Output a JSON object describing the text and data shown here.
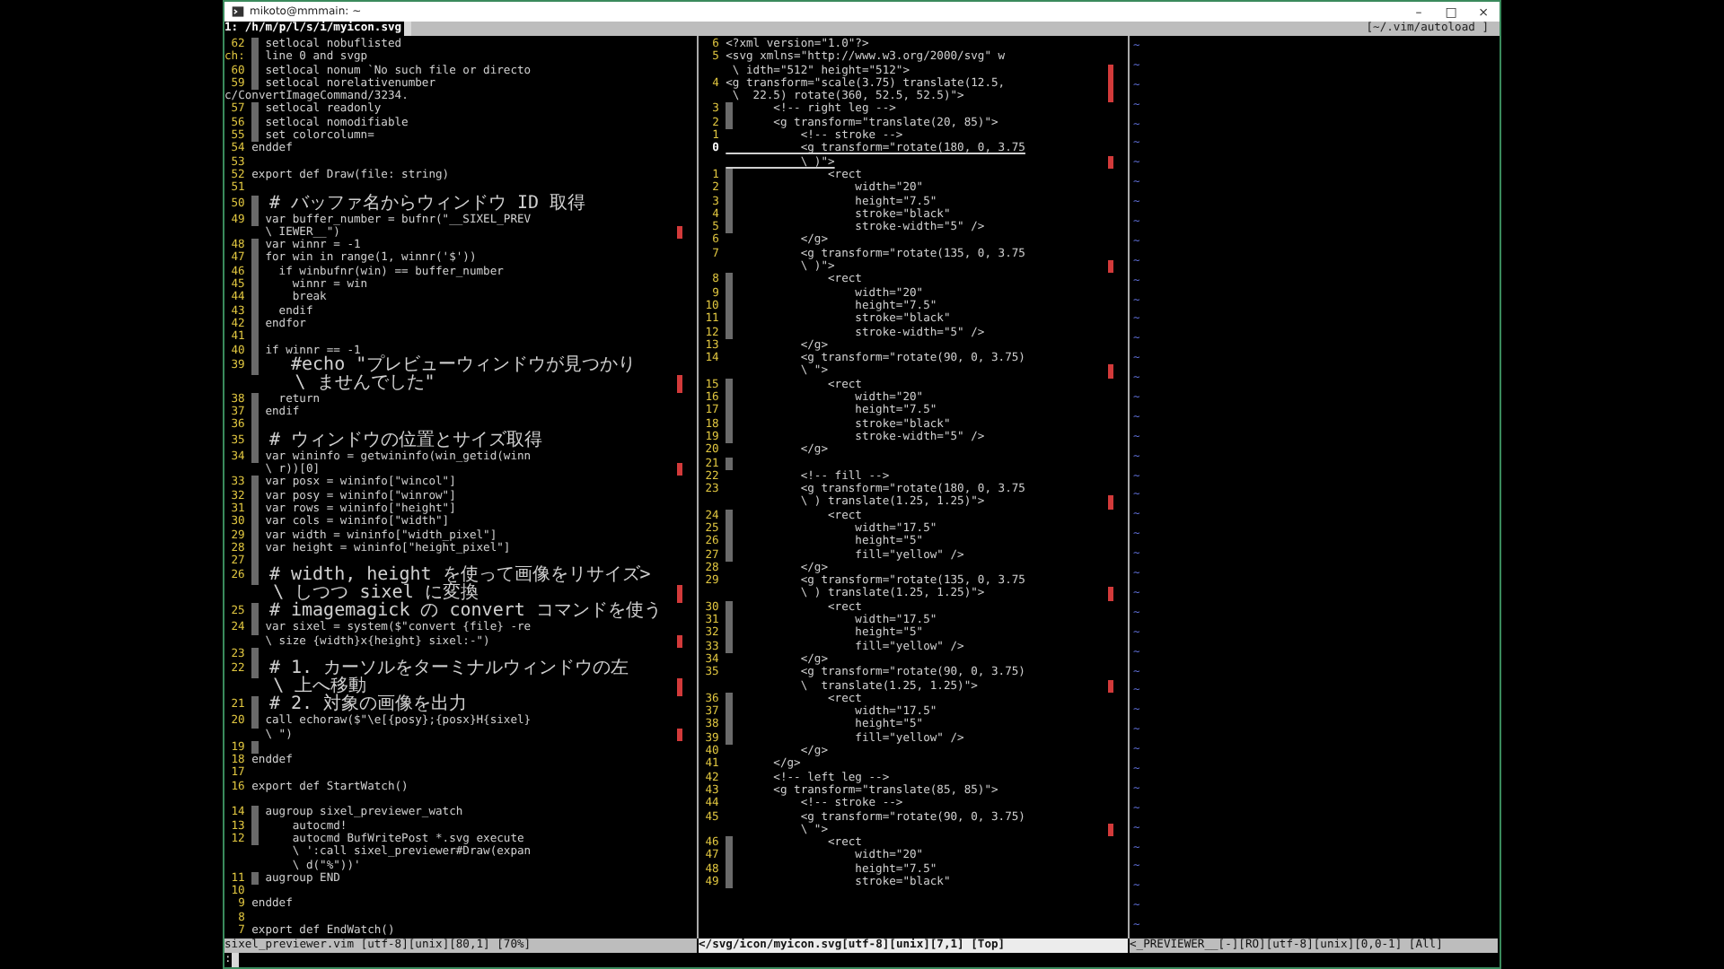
{
  "window": {
    "title": "mikoto@mmmain: ~",
    "controls": [
      "–",
      "□",
      "×"
    ]
  },
  "tabline": {
    "tabs": [
      {
        "label": "1: /h/m/p/l/s/i/myicon.svg",
        "selected": true
      }
    ],
    "cwd": "[~/.vim/autoload ]"
  },
  "panes": [
    {
      "active": false,
      "status": "sixel_previewer.vim [utf-8][unix][80,1] [70%]",
      "rows": [
        {
          "num": "62",
          "text": " setlocal nobuflisted",
          "guide": true,
          "marker": false
        },
        {
          "num": "ch:",
          "text": " line 0 and svgp",
          "guide": true,
          "marker": false
        },
        {
          "num": "60",
          "text": " setlocal nonum `No such file or directo",
          "guide": true,
          "marker": false
        },
        {
          "num": "59",
          "text": " setlocal norelativenumber",
          "guide": true,
          "marker": false
        },
        {
          "message": "c/ConvertImageCommand/3234.",
          "guide": false,
          "marker": false
        },
        {
          "num": "57",
          "text": " setlocal readonly",
          "guide": true,
          "marker": false
        },
        {
          "num": "56",
          "text": " setlocal nomodifiable",
          "guide": true,
          "marker": false
        },
        {
          "num": "55",
          "text": " set colorcolumn=",
          "guide": true,
          "marker": false
        },
        {
          "num": "54",
          "text": "enddef",
          "guide": false,
          "marker": false
        },
        {
          "num": "53",
          "guide": false,
          "marker": false
        },
        {
          "num": "52",
          "text": "export def Draw(file: string)",
          "guide": false,
          "marker": false
        },
        {
          "num": "51",
          "guide": false,
          "marker": false
        },
        {
          "num": "50",
          "text": " # バッファ名からウィンドウ ID 取得",
          "guide": true,
          "marker": false
        },
        {
          "num": "49",
          "text": " var buffer_number = bufnr(\"__SIXEL_PREV",
          "guide": true,
          "marker": false
        },
        {
          "text": "  \\ IEWER__\")",
          "guide": false,
          "marker": true
        },
        {
          "num": "48",
          "text": " var winnr = -1",
          "guide": true,
          "marker": false
        },
        {
          "num": "47",
          "text": " for win in range(1, winnr('$'))",
          "guide": true,
          "marker": false
        },
        {
          "num": "46",
          "text": "   if winbufnr(win) == buffer_number",
          "guide": true,
          "marker": false
        },
        {
          "num": "45",
          "text": "     winnr = win",
          "guide": true,
          "marker": false
        },
        {
          "num": "44",
          "text": "     break",
          "guide": true,
          "marker": false
        },
        {
          "num": "43",
          "text": "   endif",
          "guide": true,
          "marker": false
        },
        {
          "num": "42",
          "text": " endfor",
          "guide": true,
          "marker": false
        },
        {
          "num": "41",
          "guide": true,
          "marker": false
        },
        {
          "num": "40",
          "text": " if winnr == -1",
          "guide": true,
          "marker": false
        },
        {
          "num": "39",
          "text": "   #echo \"プレビューウィンドウが見つかり",
          "guide": true,
          "marker": false
        },
        {
          "text": "    \\ ませんでした\"",
          "guide": false,
          "marker": true
        },
        {
          "num": "38",
          "text": "   return",
          "guide": true,
          "marker": false
        },
        {
          "num": "37",
          "text": " endif",
          "guide": true,
          "marker": false
        },
        {
          "num": "36",
          "guide": true,
          "marker": false
        },
        {
          "num": "35",
          "text": " # ウィンドウの位置とサイズ取得",
          "guide": true,
          "marker": false
        },
        {
          "num": "34",
          "text": " var wininfo = getwininfo(win_getid(winn",
          "guide": true,
          "marker": false
        },
        {
          "text": "  \\ r))[0]",
          "guide": false,
          "marker": true
        },
        {
          "num": "33",
          "text": " var posx = wininfo[\"wincol\"]",
          "guide": true,
          "marker": false
        },
        {
          "num": "32",
          "text": " var posy = wininfo[\"winrow\"]",
          "guide": true,
          "marker": false
        },
        {
          "num": "31",
          "text": " var rows = wininfo[\"height\"]",
          "guide": true,
          "marker": false
        },
        {
          "num": "30",
          "text": " var cols = wininfo[\"width\"]",
          "guide": true,
          "marker": false
        },
        {
          "num": "29",
          "text": " var width = wininfo[\"width_pixel\"]",
          "guide": true,
          "marker": false
        },
        {
          "num": "28",
          "text": " var height = wininfo[\"height_pixel\"]",
          "guide": true,
          "marker": false
        },
        {
          "num": "27",
          "guide": true,
          "marker": false
        },
        {
          "num": "26",
          "text": " # width, height を使って画像をリサイズ>",
          "guide": true,
          "marker": false
        },
        {
          "text": "  \\ しつつ sixel に変換",
          "guide": false,
          "marker": true
        },
        {
          "num": "25",
          "text": " # imagemagick の convert コマンドを使う",
          "guide": true,
          "marker": false
        },
        {
          "num": "24",
          "text": " var sixel = system($\"convert {file} -re",
          "guide": true,
          "marker": false
        },
        {
          "text": "  \\ size {width}x{height} sixel:-\")",
          "guide": false,
          "marker": true
        },
        {
          "num": "23",
          "guide": true,
          "marker": false
        },
        {
          "num": "22",
          "text": " # 1. カーソルをターミナルウィンドウの左",
          "guide": true,
          "marker": false
        },
        {
          "text": "  \\ 上へ移動",
          "guide": false,
          "marker": true
        },
        {
          "num": "21",
          "text": " # 2. 対象の画像を出力",
          "guide": true,
          "marker": false
        },
        {
          "num": "20",
          "text": " call echoraw($\"\\e[{posy};{posx}H{sixel}",
          "guide": true,
          "marker": false
        },
        {
          "text": "  \\ \")",
          "guide": false,
          "marker": true
        },
        {
          "num": "19",
          "guide": true,
          "marker": false
        },
        {
          "num": "18",
          "text": "enddef",
          "guide": false,
          "marker": false
        },
        {
          "num": "17",
          "guide": false,
          "marker": false
        },
        {
          "num": "16",
          "text": "export def StartWatch()",
          "guide": false,
          "marker": false
        },
        {
          "guide": false,
          "marker": false
        },
        {
          "num": "14",
          "text": " augroup sixel_previewer_watch",
          "guide": true,
          "marker": false
        },
        {
          "num": "13",
          "text": "     autocmd!",
          "guide": true,
          "marker": false
        },
        {
          "num": "12",
          "text": "     autocmd BufWritePost *.svg execute",
          "guide": true,
          "marker": false
        },
        {
          "text": "      \\ ':call sixel_previewer#Draw(expan",
          "guide": false,
          "marker": false
        },
        {
          "text": "      \\ d(\"%\"))'",
          "guide": false,
          "marker": false
        },
        {
          "num": "11",
          "text": " augroup END",
          "guide": true,
          "marker": false
        },
        {
          "num": "10",
          "guide": false,
          "marker": false
        },
        {
          "num": "9",
          "text": "enddef",
          "guide": false,
          "marker": false
        },
        {
          "num": "8",
          "guide": false,
          "marker": false
        },
        {
          "num": "7",
          "text": "export def EndWatch()",
          "guide": false,
          "marker": false
        }
      ]
    },
    {
      "active": true,
      "status": "</svg/icon/myicon.svg[utf-8][unix][7,1] [Top]",
      "rows": [
        {
          "num": "6",
          "text": "<?xml version=\"1.0\"?>",
          "guide": false,
          "marker": false,
          "current": false
        },
        {
          "num": "5",
          "text": "<svg xmlns=\"http://www.w3.org/2000/svg\" w",
          "guide": false,
          "marker": false,
          "current": false
        },
        {
          "text": " \\ idth=\"512\" height=\"512\">",
          "guide": false,
          "marker": true,
          "current": false
        },
        {
          "num": "4",
          "text": "<g transform=\"scale(3.75) translate(12.5,",
          "guide": false,
          "marker": true,
          "current": false
        },
        {
          "text": " \\  22.5) rotate(360, 52.5, 52.5)\">",
          "guide": false,
          "marker": true,
          "current": false
        },
        {
          "num": "3",
          "text": "      <!-- right leg -->",
          "guide": true,
          "marker": false,
          "current": false
        },
        {
          "num": "2",
          "text": "      <g transform=\"translate(20, 85)\">",
          "guide": true,
          "marker": false,
          "current": false
        },
        {
          "num": "1",
          "text": "           <!-- stroke -->",
          "guide": false,
          "marker": false,
          "current": false
        },
        {
          "num": "0",
          "text": "           <g transform=\"rotate(180, 0, 3.75",
          "guide": false,
          "marker": false,
          "current": true
        },
        {
          "text": "           \\ )\">",
          "guide": false,
          "marker": true,
          "current": true
        },
        {
          "num": "1",
          "text": "              <rect",
          "guide": true,
          "marker": false,
          "current": false
        },
        {
          "num": "2",
          "text": "                  width=\"20\"",
          "guide": true,
          "marker": false,
          "current": false
        },
        {
          "num": "3",
          "text": "                  height=\"7.5\"",
          "guide": true,
          "marker": false,
          "current": false
        },
        {
          "num": "4",
          "text": "                  stroke=\"black\"",
          "guide": true,
          "marker": false,
          "current": false
        },
        {
          "num": "5",
          "text": "                  stroke-width=\"5\" />",
          "guide": true,
          "marker": false,
          "current": false
        },
        {
          "num": "6",
          "text": "           </g>",
          "guide": false,
          "marker": false,
          "current": false
        },
        {
          "num": "7",
          "text": "           <g transform=\"rotate(135, 0, 3.75",
          "guide": false,
          "marker": false,
          "current": false
        },
        {
          "text": "           \\ )\">",
          "guide": false,
          "marker": true,
          "current": false
        },
        {
          "num": "8",
          "text": "              <rect",
          "guide": true,
          "marker": false,
          "current": false
        },
        {
          "num": "9",
          "text": "                  width=\"20\"",
          "guide": true,
          "marker": false,
          "current": false
        },
        {
          "num": "10",
          "text": "                  height=\"7.5\"",
          "guide": true,
          "marker": false,
          "current": false
        },
        {
          "num": "11",
          "text": "                  stroke=\"black\"",
          "guide": true,
          "marker": false,
          "current": false
        },
        {
          "num": "12",
          "text": "                  stroke-width=\"5\" />",
          "guide": true,
          "marker": false,
          "current": false
        },
        {
          "num": "13",
          "text": "           </g>",
          "guide": false,
          "marker": false,
          "current": false
        },
        {
          "num": "14",
          "text": "           <g transform=\"rotate(90, 0, 3.75)",
          "guide": false,
          "marker": false,
          "current": false
        },
        {
          "text": "           \\ \">",
          "guide": false,
          "marker": true,
          "current": false
        },
        {
          "num": "15",
          "text": "              <rect",
          "guide": true,
          "marker": false,
          "current": false
        },
        {
          "num": "16",
          "text": "                  width=\"20\"",
          "guide": true,
          "marker": false,
          "current": false
        },
        {
          "num": "17",
          "text": "                  height=\"7.5\"",
          "guide": true,
          "marker": false,
          "current": false
        },
        {
          "num": "18",
          "text": "                  stroke=\"black\"",
          "guide": true,
          "marker": false,
          "current": false
        },
        {
          "num": "19",
          "text": "                  stroke-width=\"5\" />",
          "guide": true,
          "marker": false,
          "current": false
        },
        {
          "num": "20",
          "text": "           </g>",
          "guide": false,
          "marker": false,
          "current": false
        },
        {
          "num": "21",
          "guide": true,
          "marker": false,
          "current": false
        },
        {
          "num": "22",
          "text": "           <!-- fill -->",
          "guide": false,
          "marker": false,
          "current": false
        },
        {
          "num": "23",
          "text": "           <g transform=\"rotate(180, 0, 3.75",
          "guide": false,
          "marker": false,
          "current": false
        },
        {
          "text": "           \\ ) translate(1.25, 1.25)\">",
          "guide": false,
          "marker": true,
          "current": false
        },
        {
          "num": "24",
          "text": "              <rect",
          "guide": true,
          "marker": false,
          "current": false
        },
        {
          "num": "25",
          "text": "                  width=\"17.5\"",
          "guide": true,
          "marker": false,
          "current": false
        },
        {
          "num": "26",
          "text": "                  height=\"5\"",
          "guide": true,
          "marker": false,
          "current": false
        },
        {
          "num": "27",
          "text": "                  fill=\"yellow\" />",
          "guide": true,
          "marker": false,
          "current": false
        },
        {
          "num": "28",
          "text": "           </g>",
          "guide": false,
          "marker": false,
          "current": false
        },
        {
          "num": "29",
          "text": "           <g transform=\"rotate(135, 0, 3.75",
          "guide": false,
          "marker": false,
          "current": false
        },
        {
          "text": "           \\ ) translate(1.25, 1.25)\">",
          "guide": false,
          "marker": true,
          "current": false
        },
        {
          "num": "30",
          "text": "              <rect",
          "guide": true,
          "marker": false,
          "current": false
        },
        {
          "num": "31",
          "text": "                  width=\"17.5\"",
          "guide": true,
          "marker": false,
          "current": false
        },
        {
          "num": "32",
          "text": "                  height=\"5\"",
          "guide": true,
          "marker": false,
          "current": false
        },
        {
          "num": "33",
          "text": "                  fill=\"yellow\" />",
          "guide": true,
          "marker": false,
          "current": false
        },
        {
          "num": "34",
          "text": "           </g>",
          "guide": false,
          "marker": false,
          "current": false
        },
        {
          "num": "35",
          "text": "           <g transform=\"rotate(90, 0, 3.75)",
          "guide": false,
          "marker": false,
          "current": false
        },
        {
          "text": "           \\  translate(1.25, 1.25)\">",
          "guide": false,
          "marker": true,
          "current": false
        },
        {
          "num": "36",
          "text": "              <rect",
          "guide": true,
          "marker": false,
          "current": false
        },
        {
          "num": "37",
          "text": "                  width=\"17.5\"",
          "guide": true,
          "marker": false,
          "current": false
        },
        {
          "num": "38",
          "text": "                  height=\"5\"",
          "guide": true,
          "marker": false,
          "current": false
        },
        {
          "num": "39",
          "text": "                  fill=\"yellow\" />",
          "guide": true,
          "marker": false,
          "current": false
        },
        {
          "num": "40",
          "text": "           </g>",
          "guide": false,
          "marker": false,
          "current": false
        },
        {
          "num": "41",
          "text": "       </g>",
          "guide": false,
          "marker": false,
          "current": false
        },
        {
          "num": "42",
          "text": "       <!-- left leg -->",
          "guide": false,
          "marker": false,
          "current": false
        },
        {
          "num": "43",
          "text": "       <g transform=\"translate(85, 85)\">",
          "guide": false,
          "marker": false,
          "current": false
        },
        {
          "num": "44",
          "text": "           <!-- stroke -->",
          "guide": false,
          "marker": false,
          "current": false
        },
        {
          "num": "45",
          "text": "           <g transform=\"rotate(90, 0, 3.75)",
          "guide": false,
          "marker": false,
          "current": false
        },
        {
          "text": "           \\ \">",
          "guide": false,
          "marker": true,
          "current": false
        },
        {
          "num": "46",
          "text": "              <rect",
          "guide": true,
          "marker": false,
          "current": false
        },
        {
          "num": "47",
          "text": "                  width=\"20\"",
          "guide": true,
          "marker": false,
          "current": false
        },
        {
          "num": "48",
          "text": "                  height=\"7.5\"",
          "guide": true,
          "marker": false,
          "current": false
        },
        {
          "num": "49",
          "text": "                  stroke=\"black\"",
          "guide": true,
          "marker": false,
          "current": false
        }
      ]
    },
    {
      "active": false,
      "status": "<_PREVIEWER__[-][RO][utf-8][unix][0,0-1] [All]",
      "tildes": [
        "~",
        "~",
        "~",
        "~",
        "~",
        "~",
        "~",
        "~",
        "~",
        "~",
        "~",
        "~",
        "~",
        "~",
        "~",
        "~",
        "~",
        "~",
        "~",
        "~",
        "~",
        "~",
        "~",
        "~",
        "~",
        "~",
        "~",
        "~",
        "~",
        "~",
        "~",
        "~",
        "~",
        "~",
        "~",
        "~",
        "~",
        "~",
        "~",
        "~",
        "~",
        "~",
        "~",
        "~",
        "~",
        "~"
      ]
    }
  ],
  "command_line": ":"
}
